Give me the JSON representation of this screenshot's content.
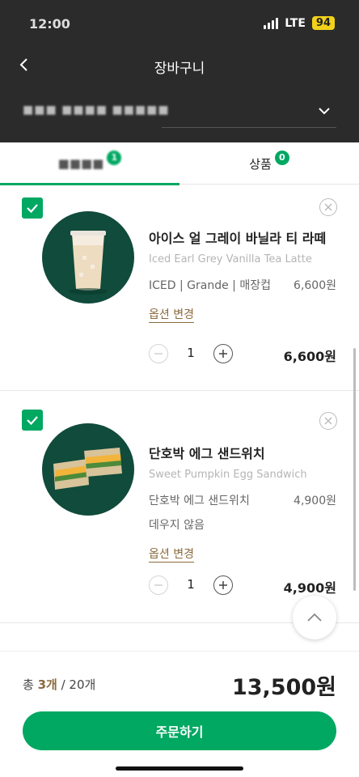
{
  "status_bar": {
    "time": "12:00",
    "network": "LTE",
    "battery": "94"
  },
  "header": {
    "title": "장바구니",
    "store_name": "■■■ ■■■■ ■■■■■"
  },
  "tabs": [
    {
      "label": "■■■■",
      "badge": "1"
    },
    {
      "label": "상품",
      "badge": "0"
    }
  ],
  "items": [
    {
      "name_ko": "아이스 얼 그레이 바닐라 티 라떼",
      "name_en": "Iced Earl Grey Vanilla Tea Latte",
      "options": "ICED | Grande | 매장컵",
      "option_price": "6,600원",
      "option_change": "옵션 변경",
      "quantity": "1",
      "total": "6,600원"
    },
    {
      "name_ko": "단호박 에그 샌드위치",
      "name_en": "Sweet Pumpkin Egg Sandwich",
      "options": "단호박 에그 샌드위치",
      "options_extra": "데우지 않음",
      "option_price": "4,900원",
      "option_change": "옵션 변경",
      "quantity": "1",
      "total": "4,900원"
    }
  ],
  "summary": {
    "prefix": "총 ",
    "count": "3개",
    "separator": " / ",
    "max": "20개",
    "total_price": "13,500원"
  },
  "order_button": "주문하기",
  "colors": {
    "accent": "#00a862",
    "dark": "#2b2b2b",
    "brown": "#8b6a3e",
    "thumb_bg": "#104b3b"
  }
}
